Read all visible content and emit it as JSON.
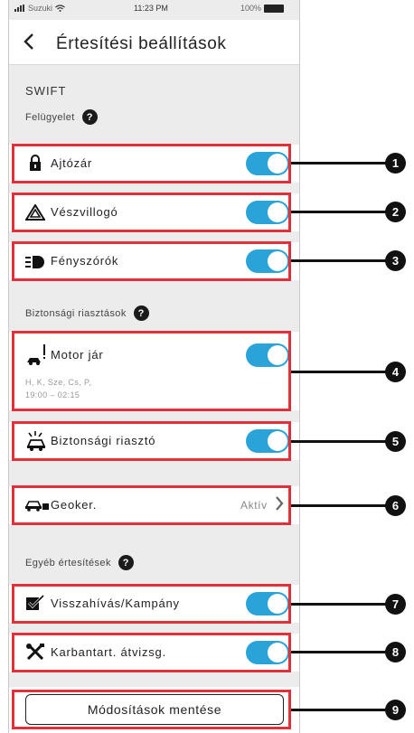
{
  "status_bar": {
    "carrier": "Suzuki",
    "time": "11:23 PM",
    "battery": "100%"
  },
  "header": {
    "back_icon": "chevron-left-icon",
    "title": "Értesítési beállítások"
  },
  "vehicle_name": "SWIFT",
  "sections": {
    "supervision": {
      "title": "Felügyelet"
    },
    "security": {
      "title": "Biztonsági riasztások"
    },
    "other": {
      "title": "Egyéb értesítések"
    }
  },
  "rows": {
    "door_lock": {
      "icon": "padlock-icon",
      "label": "Ajtózár",
      "enabled": true
    },
    "hazard": {
      "icon": "hazard-triangle-icon",
      "label": "Vészvillogó",
      "enabled": true
    },
    "headlights": {
      "icon": "headlight-icon",
      "label": "Fényszórók",
      "enabled": true
    },
    "engine": {
      "icon": "engine-running-icon",
      "label": "Motor jár",
      "enabled": true,
      "days": "H, K, Sze, Cs, P,",
      "hours": "19:00 – 02:15"
    },
    "alarm": {
      "icon": "car-alarm-icon",
      "label": "Biztonsági riasztó",
      "enabled": true
    },
    "geofence": {
      "icon": "car-geofence-icon",
      "label": "Geoker.",
      "status": "Aktív",
      "chevron": "chevron-right-icon"
    },
    "recall": {
      "icon": "checklist-icon",
      "label": "Visszahívás/Kampány",
      "enabled": true
    },
    "maintenance": {
      "icon": "tools-icon",
      "label": "Karbantart. átvizsg.",
      "enabled": true
    }
  },
  "save_button": {
    "label": "Módosítások mentése"
  },
  "callouts": [
    "1",
    "2",
    "3",
    "4",
    "5",
    "6",
    "7",
    "8",
    "9"
  ],
  "colors": {
    "toggle_on": "#2aa3d9",
    "highlight": "#e0303a",
    "callout": "#111111"
  }
}
